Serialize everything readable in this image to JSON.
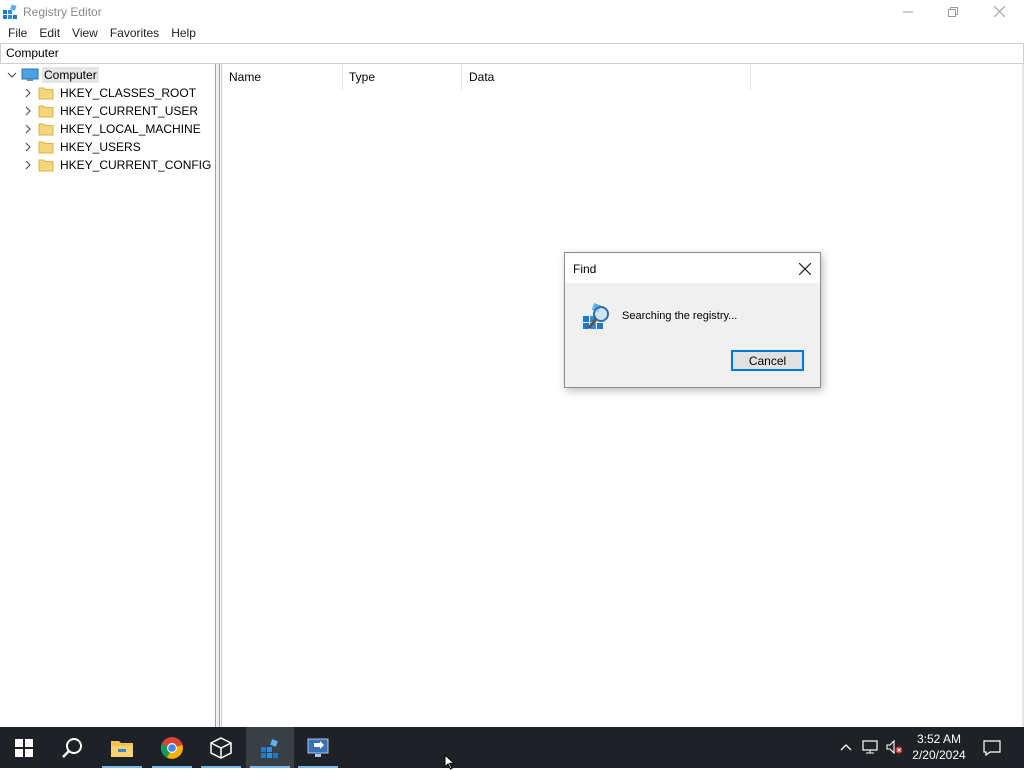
{
  "window": {
    "title": "Registry Editor",
    "controls": [
      "minimize",
      "restore",
      "close"
    ]
  },
  "menu": [
    "File",
    "Edit",
    "View",
    "Favorites",
    "Help"
  ],
  "address": "Computer",
  "tree": {
    "root": "Computer",
    "children": [
      "HKEY_CLASSES_ROOT",
      "HKEY_CURRENT_USER",
      "HKEY_LOCAL_MACHINE",
      "HKEY_USERS",
      "HKEY_CURRENT_CONFIG"
    ]
  },
  "list": {
    "columns": [
      "Name",
      "Type",
      "Data"
    ]
  },
  "find_dialog": {
    "title": "Find",
    "message": "Searching the registry...",
    "cancel_label": "Cancel"
  },
  "taskbar": {
    "apps": [
      "start-icon",
      "search-icon",
      "file-explorer-icon",
      "chrome-icon",
      "3d-viewer-icon",
      "registry-editor-icon",
      "remote-desktop-icon"
    ],
    "clock_time": "3:52 AM",
    "clock_date": "2/20/2024"
  },
  "colors": {
    "accent": "#0078d7",
    "taskbar_bg": "#1e2227",
    "folder": "#f5d67a"
  }
}
